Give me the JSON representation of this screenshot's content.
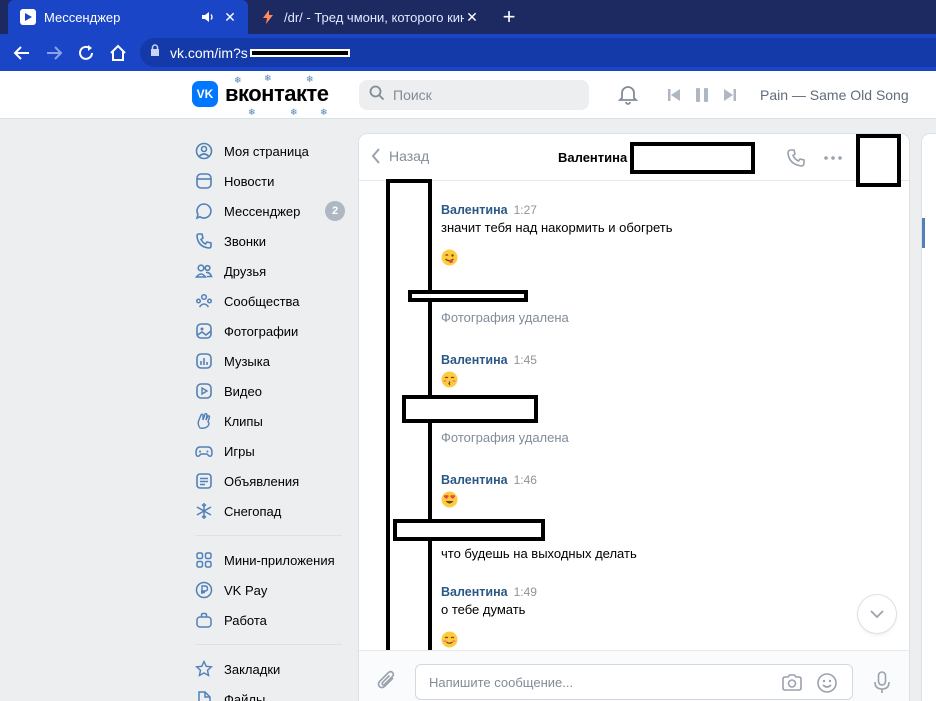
{
  "browser": {
    "tabs": [
      {
        "title": "Мессенджер",
        "active": true
      },
      {
        "title": "/dr/ - Тред чмони, которого кинули",
        "active": false
      }
    ],
    "url": "vk.com/im?s"
  },
  "header": {
    "logo_text": "вконтакте",
    "search_placeholder": "Поиск",
    "now_playing": "Pain — Same Old Song"
  },
  "menu": {
    "items": [
      {
        "label": "Моя страница",
        "icon": "user-circle-icon"
      },
      {
        "label": "Новости",
        "icon": "newsfeed-icon"
      },
      {
        "label": "Мессенджер",
        "icon": "message-icon",
        "badge": "2"
      },
      {
        "label": "Звонки",
        "icon": "phone-icon"
      },
      {
        "label": "Друзья",
        "icon": "friends-icon"
      },
      {
        "label": "Сообщества",
        "icon": "groups-icon"
      },
      {
        "label": "Фотографии",
        "icon": "photo-icon"
      },
      {
        "label": "Музыка",
        "icon": "music-icon"
      },
      {
        "label": "Видео",
        "icon": "video-icon"
      },
      {
        "label": "Клипы",
        "icon": "clips-icon"
      },
      {
        "label": "Игры",
        "icon": "gamepad-icon"
      },
      {
        "label": "Объявления",
        "icon": "ads-icon"
      },
      {
        "label": "Снегопад",
        "icon": "snowflake-icon"
      }
    ],
    "items2": [
      {
        "label": "Мини-приложения",
        "icon": "apps-icon"
      },
      {
        "label": "VK Pay",
        "icon": "vkpay-icon"
      },
      {
        "label": "Работа",
        "icon": "briefcase-icon"
      }
    ],
    "items3": [
      {
        "label": "Закладки",
        "icon": "star-icon"
      },
      {
        "label": "Файлы",
        "icon": "file-icon"
      }
    ]
  },
  "chat": {
    "back_label": "Назад",
    "peer_name": "Валентина",
    "messages": [
      {
        "author": "Валентина",
        "time": "1:27",
        "text": "значит тебя над накормить и обогреть"
      },
      {
        "deleted": "Фотография удалена"
      },
      {
        "author": "Валентина",
        "time": "1:45"
      },
      {
        "deleted": "Фотография удалена"
      },
      {
        "author": "Валентина",
        "time": "1:46"
      },
      {
        "text": "что будешь на выходных делать"
      },
      {
        "author": "Валентина",
        "time": "1:49",
        "text": "о тебе думать"
      }
    ],
    "composer_placeholder": "Напишите сообщение..."
  },
  "colors": {
    "accent": "#0077ff",
    "link": "#2a5885",
    "menu_icon": "#5181b8",
    "tab_active": "#1a45c7",
    "tabbar": "#1d2a61"
  }
}
